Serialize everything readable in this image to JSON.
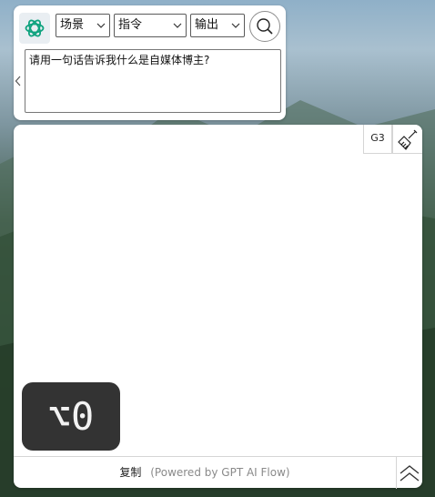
{
  "toolbar": {
    "scene_select": "场景",
    "command_select": "指令",
    "output_select": "输出",
    "prompt_text": "请用一句话告诉我什么是自媒体博主?"
  },
  "output_panel": {
    "model_badge": "G3",
    "copy_label": "复制",
    "powered_by": "(Powered by GPT AI Flow)"
  },
  "shortcut_overlay": {
    "keys": "⌥0"
  },
  "icons": {
    "logo": "openai-logo-icon",
    "search": "search-icon",
    "collapse": "chevron-left-icon",
    "clean": "broom-icon",
    "scroll_top": "double-chevron-up-icon",
    "dropdown": "chevron-down-icon"
  },
  "colors": {
    "logo_green": "#10a37f",
    "hud_bg": "#282828",
    "powered_gray": "#8a8a8a"
  }
}
